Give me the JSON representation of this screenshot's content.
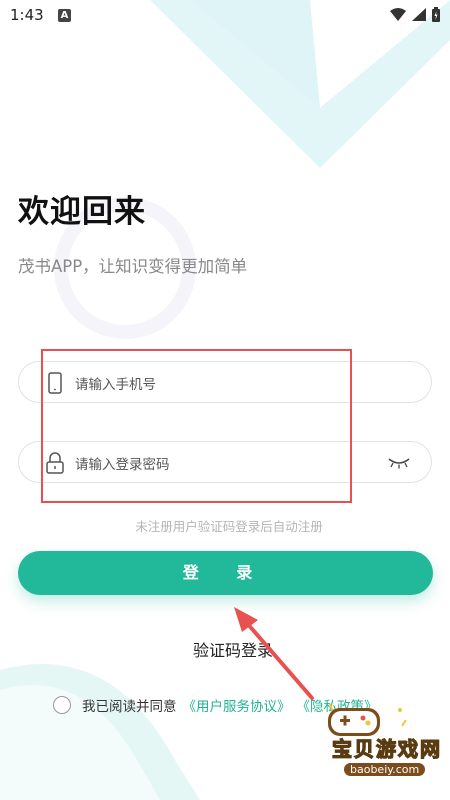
{
  "status_bar": {
    "time": "1:43",
    "notification_letter": "A"
  },
  "header": {
    "title": "欢迎回来",
    "subtitle": "茂书APP，让知识变得更加简单"
  },
  "form": {
    "phone_placeholder": "请输入手机号",
    "password_placeholder": "请输入登录密码",
    "hint": "未注册用户验证码登录后自动注册",
    "login_label": "登 录",
    "code_login_label": "验证码登录"
  },
  "agreement": {
    "text": "我已阅读并同意",
    "user_agreement": "《用户服务协议》",
    "privacy_policy": "《隐私政策》",
    "checked": false
  },
  "watermark": {
    "title": "宝贝游戏网",
    "url": "baobeiy.com"
  },
  "colors": {
    "accent": "#22b89a",
    "annotation_red": "#e8514f",
    "bg_decor": "#dff4f7"
  }
}
